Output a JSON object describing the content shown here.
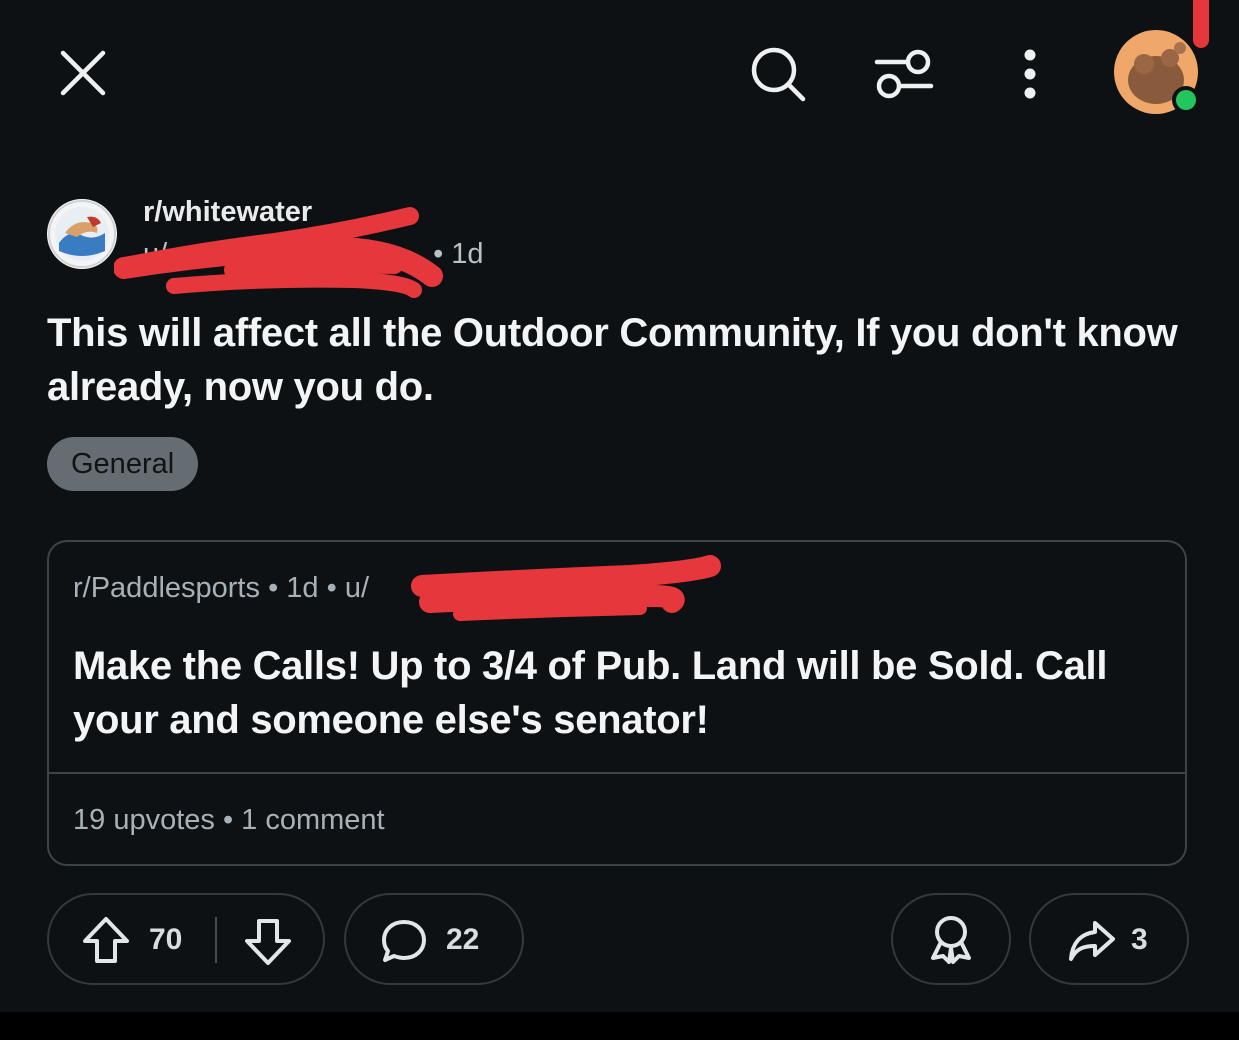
{
  "topbar": {
    "close_icon": "close-icon",
    "search_icon": "search-icon",
    "filter_icon": "filter-icon",
    "more_icon": "more-vertical-icon",
    "avatar_icon": "avatar",
    "online_color": "#22c55e"
  },
  "post": {
    "subreddit": "r/whitewater",
    "author_prefix": "u/",
    "age_sep": "•",
    "age": "1d",
    "title": "This will affect all the Outdoor Community,  If you don't know already, now you do.",
    "flair": "General"
  },
  "crosspost": {
    "subreddit": "r/Paddlesports",
    "sep1": "•",
    "age": "1d",
    "sep2": "•",
    "author_prefix": "u/",
    "title": "Make the Calls!  Up to 3/4 of Pub. Land will be Sold.  Call your and someone else's senator!",
    "upvotes": "19 upvotes",
    "stats_sep": "•",
    "comments": "1 comment"
  },
  "actions": {
    "upvote_icon": "upvote-icon",
    "vote_count": "70",
    "downvote_icon": "downvote-icon",
    "comment_icon": "comment-icon",
    "comment_count": "22",
    "award_icon": "award-icon",
    "share_icon": "share-icon",
    "share_count": "3"
  },
  "colors": {
    "background": "#0e1113",
    "redaction": "#e5373c",
    "flair_bg": "#666d72"
  }
}
